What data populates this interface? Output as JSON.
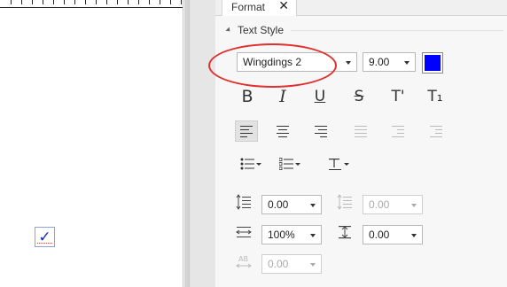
{
  "panel": {
    "tab_label": "Format",
    "tab_close": "✕",
    "section_title": "Text Style",
    "font": {
      "value": "Wingdings 2"
    },
    "size": {
      "value": "9.00"
    },
    "font_color": "#0000ff"
  },
  "style_buttons": {
    "bold": "B",
    "italic": "I",
    "underline": "U",
    "strikethrough": "S",
    "superscript": "T'",
    "subscript": "T₁"
  },
  "spacing": {
    "line_spacing": "0.00",
    "paragraph_spacing": "0.00",
    "scale": "100%",
    "spacing_after": "0.00",
    "character_spacing": "0.00"
  },
  "document": {
    "glyph": "✓"
  }
}
